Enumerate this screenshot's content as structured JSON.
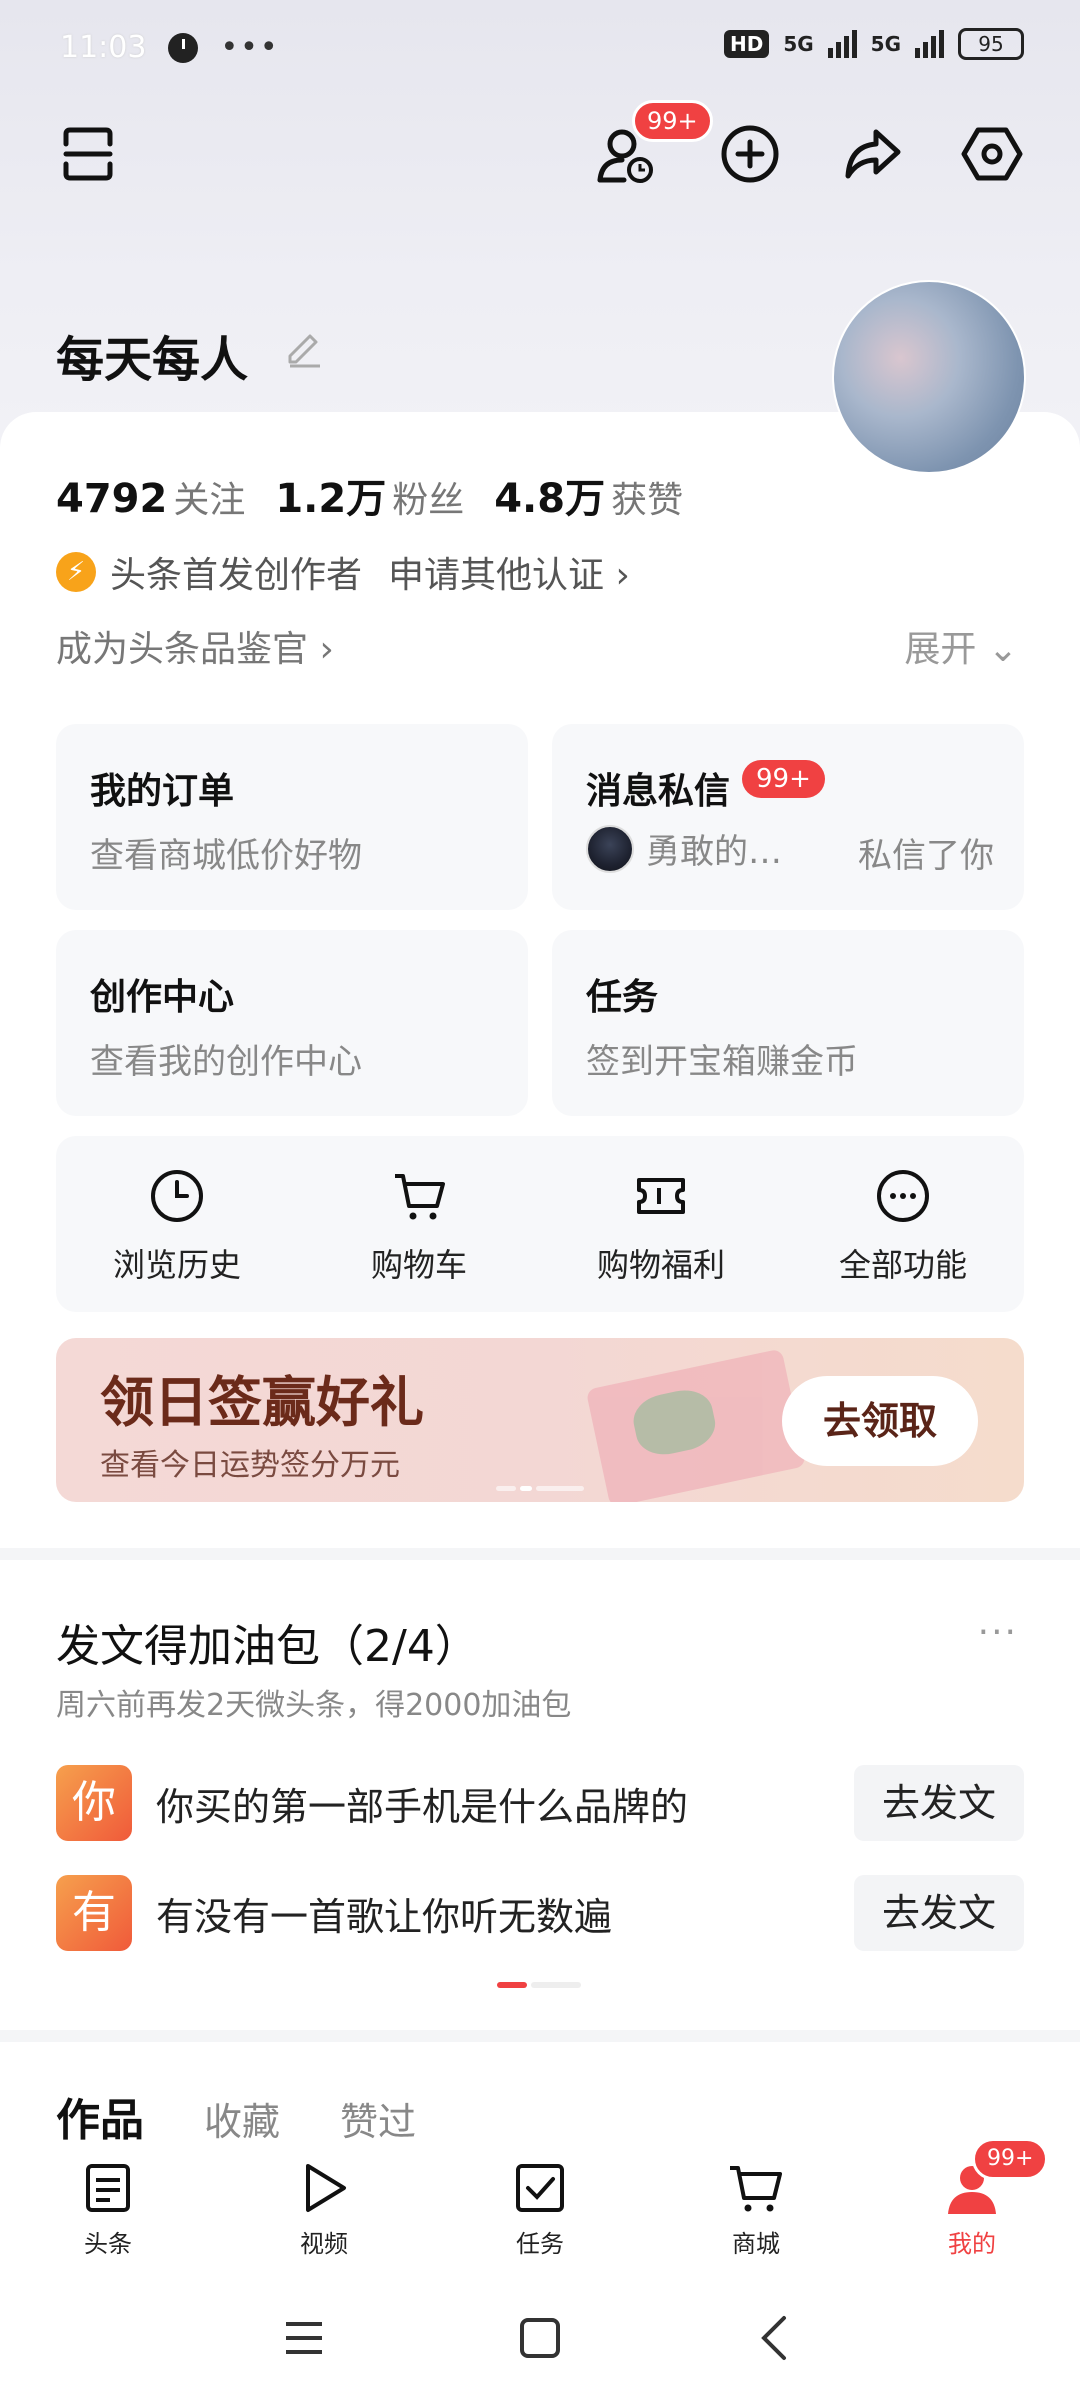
{
  "status_bar": {
    "time": "11:03",
    "more": "•••",
    "hd": "HD",
    "net1": "5G",
    "net2": "5G",
    "battery": "95"
  },
  "header": {
    "notify_badge": "99+"
  },
  "profile": {
    "username": "每天每人",
    "following_count": "4792",
    "following_label": "关注",
    "fans_count": "1.2万",
    "fans_label": "粉丝",
    "likes_count": "4.8万",
    "likes_label": "获赞",
    "creator_label": "头条首发创作者",
    "apply_label": "申请其他认证 ›",
    "judge_label": "成为头条品鉴官 ›",
    "expand_label": "展开 ⌄"
  },
  "tiles": {
    "orders": {
      "title": "我的订单",
      "sub": "查看商城低价好物"
    },
    "messages": {
      "title": "消息私信",
      "badge": "99+",
      "sender": "勇敢的…",
      "tail": "私信了你"
    },
    "creation": {
      "title": "创作中心",
      "sub": "查看我的创作中心"
    },
    "tasks": {
      "title": "任务",
      "sub": "签到开宝箱赚金币"
    }
  },
  "shortcuts": [
    {
      "label": "浏览历史",
      "icon": "clock-icon"
    },
    {
      "label": "购物车",
      "icon": "cart-icon"
    },
    {
      "label": "购物福利",
      "icon": "coupon-icon"
    },
    {
      "label": "全部功能",
      "icon": "more-icon"
    }
  ],
  "banner": {
    "title": "领日签赢好礼",
    "sub": "查看今日运势签分万元",
    "button": "去领取"
  },
  "task_section": {
    "title": "发文得加油包（2/4）",
    "more": "···",
    "sub": "周六前再发2天微头条，得2000加油包",
    "items": [
      {
        "icon_char": "你",
        "text": "你买的第一部手机是什么品牌的",
        "button": "去发文"
      },
      {
        "icon_char": "有",
        "text": "有没有一首歌让你听无数遍",
        "button": "去发文"
      }
    ]
  },
  "work_tabs": [
    {
      "label": "作品",
      "active": true
    },
    {
      "label": "收藏",
      "active": false
    },
    {
      "label": "赞过",
      "active": false
    }
  ],
  "bottom_nav": [
    {
      "label": "头条",
      "icon": "article-icon"
    },
    {
      "label": "视频",
      "icon": "play-icon"
    },
    {
      "label": "任务",
      "icon": "task-check-icon"
    },
    {
      "label": "商城",
      "icon": "mall-cart-icon"
    },
    {
      "label": "我的",
      "icon": "profile-icon",
      "badge": "99+"
    }
  ],
  "colors": {
    "accent": "#f04142",
    "banner_text": "#6b2a1a"
  }
}
